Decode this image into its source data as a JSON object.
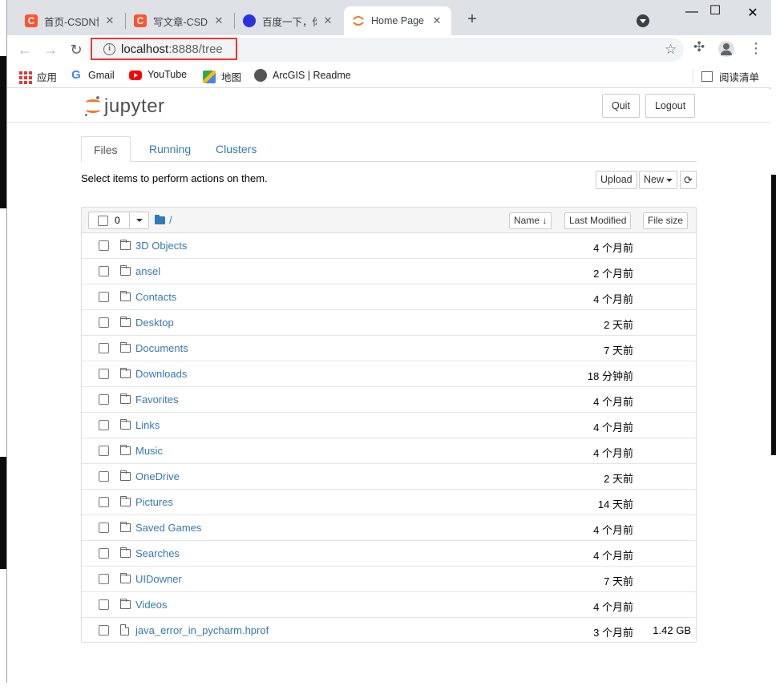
{
  "browser": {
    "tabs": [
      {
        "title": "首页-CSDN博客",
        "favicon": "csdn-icon"
      },
      {
        "title": "写文章-CSDN博客",
        "favicon": "csdn-icon"
      },
      {
        "title": "百度一下，你就知道",
        "favicon": "baidu-icon"
      },
      {
        "title": "Home Page - Select",
        "favicon": "jupyter-icon"
      }
    ],
    "url_host": "localhost",
    "url_rest": ":8888/tree",
    "bookmarks": [
      {
        "label": "应用",
        "icon": "apps-grid-icon"
      },
      {
        "label": "Gmail",
        "icon": "google-icon"
      },
      {
        "label": "YouTube",
        "icon": "youtube-icon"
      },
      {
        "label": "地图",
        "icon": "maps-icon"
      },
      {
        "label": "ArcGIS | Readme",
        "icon": "arcgis-icon"
      }
    ],
    "reading_list": "阅读清单",
    "csdn_letter": "C"
  },
  "jupyter": {
    "logo_text": "jupyter",
    "quit_label": "Quit",
    "logout_label": "Logout",
    "tabs": {
      "files": "Files",
      "running": "Running",
      "clusters": "Clusters"
    },
    "hint": "Select items to perform actions on them.",
    "upload_label": "Upload",
    "new_label": "New",
    "selected_count": "0",
    "breadcrumb": "/",
    "sort": {
      "name": "Name",
      "last_modified": "Last Modified",
      "file_size": "File size"
    },
    "files": [
      {
        "name": "3D Objects",
        "modified": "4 个月前",
        "size": "",
        "type": "folder"
      },
      {
        "name": "ansel",
        "modified": "2 个月前",
        "size": "",
        "type": "folder"
      },
      {
        "name": "Contacts",
        "modified": "4 个月前",
        "size": "",
        "type": "folder"
      },
      {
        "name": "Desktop",
        "modified": "2 天前",
        "size": "",
        "type": "folder"
      },
      {
        "name": "Documents",
        "modified": "7 天前",
        "size": "",
        "type": "folder"
      },
      {
        "name": "Downloads",
        "modified": "18 分钟前",
        "size": "",
        "type": "folder"
      },
      {
        "name": "Favorites",
        "modified": "4 个月前",
        "size": "",
        "type": "folder"
      },
      {
        "name": "Links",
        "modified": "4 个月前",
        "size": "",
        "type": "folder"
      },
      {
        "name": "Music",
        "modified": "4 个月前",
        "size": "",
        "type": "folder"
      },
      {
        "name": "OneDrive",
        "modified": "2 天前",
        "size": "",
        "type": "folder"
      },
      {
        "name": "Pictures",
        "modified": "14 天前",
        "size": "",
        "type": "folder"
      },
      {
        "name": "Saved Games",
        "modified": "4 个月前",
        "size": "",
        "type": "folder"
      },
      {
        "name": "Searches",
        "modified": "4 个月前",
        "size": "",
        "type": "folder"
      },
      {
        "name": "UIDowner",
        "modified": "7 天前",
        "size": "",
        "type": "folder"
      },
      {
        "name": "Videos",
        "modified": "4 个月前",
        "size": "",
        "type": "folder"
      },
      {
        "name": "java_error_in_pycharm.hprof",
        "modified": "3 个月前",
        "size": "1.42 GB",
        "type": "file"
      }
    ]
  },
  "colors": {
    "accent": "#337ab7",
    "jupyter_orange": "#f37726",
    "highlight": "#e53935"
  }
}
